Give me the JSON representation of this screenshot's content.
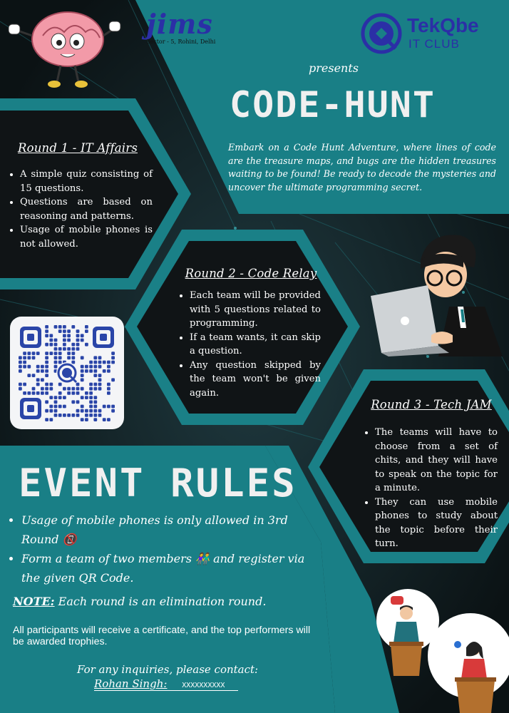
{
  "header": {
    "jims_logo_text": "jims",
    "jims_subtitle": "Sector - 5, Rohini, Delhi",
    "club_name": "TekQbe",
    "club_sub": "IT CLUB",
    "presents": "presents",
    "title": "CODE-HUNT",
    "tagline": "Embark on a Code Hunt Adventure, where lines of code are the treasure maps, and bugs are the hidden treasures waiting to be found! Be ready to decode the mysteries and uncover the ultimate programming secret."
  },
  "rounds": [
    {
      "title": "Round 1 - IT Affairs",
      "points": [
        "A simple quiz consisting of 15 questions.",
        "Questions are based on reasoning and patterns.",
        "Usage of mobile phones is not allowed."
      ]
    },
    {
      "title": "Round 2 - Code Relay",
      "points": [
        "Each team will be provided with 5 questions related to programming.",
        "If a team wants, it can skip a question.",
        "Any question skipped by the team won't be given again."
      ]
    },
    {
      "title": "Round 3 - Tech JAM",
      "points": [
        "The teams will have to choose from a set of chits, and they will have to speak on the topic for a minute.",
        "They can use mobile phones to study about the topic before their turn."
      ]
    }
  ],
  "event_rules": {
    "heading": "EVENT RULES",
    "items": [
      "Usage of mobile phones is only allowed in 3rd Round",
      "Form a team of two members",
      "and register via the given QR Code."
    ],
    "emoji_phone": "📵",
    "emoji_team": "👫",
    "note_label": "NOTE:",
    "note_text": "Each round is an elimination round.",
    "certificate": "All participants will receive a certificate, and the top performers will be awarded trophies.",
    "contact_prompt": "For any inquiries, please contact:",
    "contact_name": "Rohan Singh:",
    "contact_number": "XXXXXXXXXX"
  },
  "colors": {
    "teal": "#197f86",
    "dark": "#101416",
    "background": "#0d1518",
    "brain": "#f29aa8",
    "logo_blue": "#2b2fa6"
  },
  "icons": {
    "brain": "brain-mascot-icon",
    "coder": "programmer-at-laptop-icon",
    "speakers": "speakers-at-podium-icon",
    "qr": "qr-code-icon"
  }
}
